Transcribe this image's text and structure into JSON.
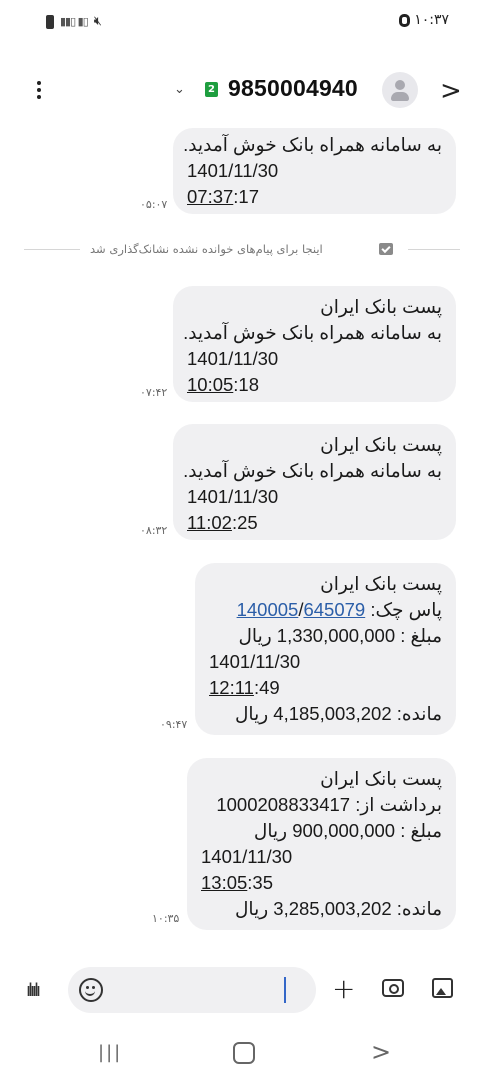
{
  "status_bar": {
    "time": "۱۰:۳۷"
  },
  "header": {
    "sim_number": "2",
    "phone_number": "9850004940"
  },
  "unread_marker": "اینجا برای پیام‌های خوانده نشده نشانک‌گذاری شد",
  "messages": [
    {
      "lines": [
        "به سامانه همراه بانک خوش آمدید.",
        "1401/11/30"
      ],
      "time_underlined": "07:37",
      "time_rest": ":17",
      "timestamp": "۰۵:۰۷"
    },
    {
      "lines": [
        "پست بانک ایران",
        "به سامانه همراه بانک خوش آمدید.",
        "1401/11/30"
      ],
      "time_underlined": "10:05",
      "time_rest": ":18",
      "timestamp": "۰۷:۴۲"
    },
    {
      "lines": [
        "پست بانک ایران",
        "به سامانه همراه بانک خوش آمدید.",
        "1401/11/30"
      ],
      "time_underlined": "11:02",
      "time_rest": ":25",
      "timestamp": "۰۸:۳۲"
    },
    {
      "bank": "پست بانک ایران",
      "pass_label": "پاس چک:",
      "pass_code_1": "140005",
      "pass_code_2": "645079",
      "amount_line": "مبلغ : 1,330,000,000 ریال",
      "date": "1401/11/30",
      "time_underlined": "12:11",
      "time_rest": ":49",
      "balance_line": "مانده: 4,185,003,202 ریال",
      "timestamp": "۰۹:۴۷"
    },
    {
      "bank": "پست بانک ایران",
      "withdraw_line": "برداشت از: 1000208833417",
      "amount_line": "مبلغ : 900,000,000 ریال",
      "date": "1401/11/30",
      "time_underlined": "13:05",
      "time_rest": ":35",
      "balance_line": "مانده: 3,285,003,202 ریال",
      "timestamp": "۱۰:۳۵"
    }
  ],
  "composer": {
    "placeholder": ""
  },
  "icons": {
    "more": "kebab-icon",
    "dropdown": "chevron-down-icon",
    "contact": "avatar-icon",
    "back": "chevron-right-icon",
    "voice": "voice-wave-icon",
    "emoji": "emoji-icon",
    "attach": "plus-icon",
    "camera": "camera-icon",
    "gallery": "gallery-icon"
  }
}
